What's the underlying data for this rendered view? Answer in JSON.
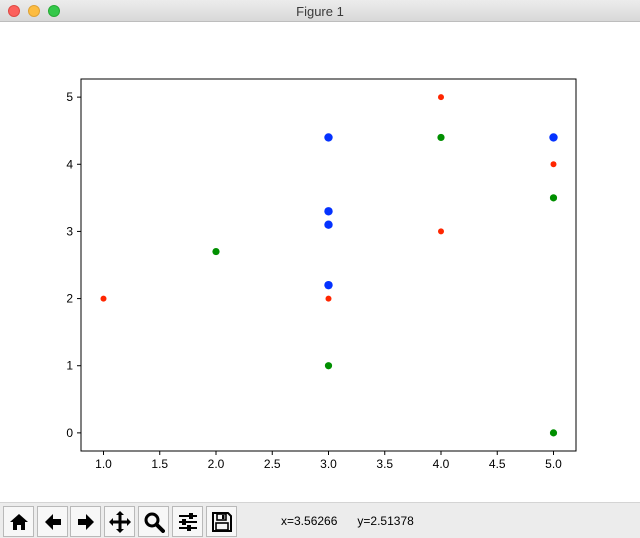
{
  "window": {
    "title": "Figure 1"
  },
  "toolbar": {
    "buttons": [
      {
        "name": "home-button",
        "icon": "home-icon"
      },
      {
        "name": "back-button",
        "icon": "arrow-left-icon"
      },
      {
        "name": "forward-button",
        "icon": "arrow-right-icon"
      },
      {
        "name": "pan-button",
        "icon": "move-icon"
      },
      {
        "name": "zoom-button",
        "icon": "magnifier-icon"
      },
      {
        "name": "configure-subplots-button",
        "icon": "sliders-icon"
      },
      {
        "name": "save-button",
        "icon": "floppy-disk-icon"
      }
    ],
    "coords_x": "x=3.56266",
    "coords_y": "y=2.51378"
  },
  "chart_data": {
    "type": "scatter",
    "xlim": [
      0.8,
      5.2
    ],
    "ylim": [
      -0.27,
      5.27
    ],
    "xticks": [
      1.0,
      1.5,
      2.0,
      2.5,
      3.0,
      3.5,
      4.0,
      4.5,
      5.0
    ],
    "xtick_labels": [
      "1.0",
      "1.5",
      "2.0",
      "2.5",
      "3.0",
      "3.5",
      "4.0",
      "4.5",
      "5.0"
    ],
    "yticks": [
      0,
      1,
      2,
      3,
      4,
      5
    ],
    "ytick_labels": [
      "0",
      "1",
      "2",
      "3",
      "4",
      "5"
    ],
    "grid": false,
    "series": [
      {
        "color": "#0432ff",
        "marker_size": "large",
        "points": [
          [
            3,
            4.4
          ],
          [
            3,
            3.3
          ],
          [
            3,
            3.1
          ],
          [
            3,
            2.2
          ],
          [
            5,
            4.4
          ]
        ]
      },
      {
        "color": "#ff2600",
        "marker_size": "small",
        "points": [
          [
            1,
            2
          ],
          [
            3,
            2
          ],
          [
            4,
            5
          ],
          [
            4,
            3
          ],
          [
            5,
            4
          ]
        ]
      },
      {
        "color": "#008f00",
        "marker_size": "medium",
        "points": [
          [
            2,
            2.7
          ],
          [
            3,
            1
          ],
          [
            4,
            4.4
          ],
          [
            5,
            3.5
          ],
          [
            5,
            0
          ]
        ]
      }
    ]
  }
}
